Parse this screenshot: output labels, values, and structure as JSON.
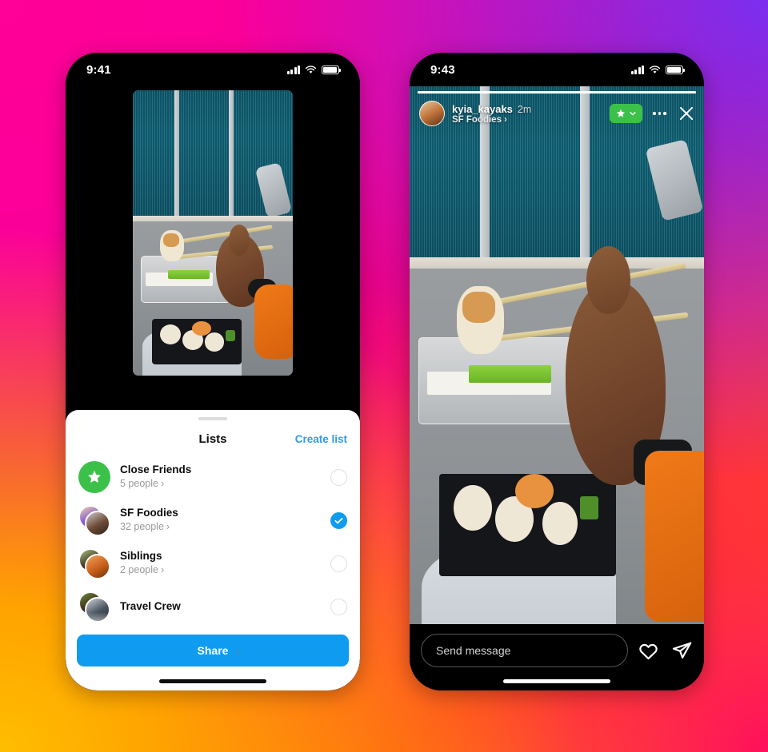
{
  "background": {
    "gradient_colors": [
      "#F5009B",
      "#7B2FF0",
      "#FF0F5B",
      "#FFA300",
      "#FFBE00"
    ]
  },
  "accent_colors": {
    "instagram_blue": "#0f9bf0",
    "close_friends_green": "#3BC14A",
    "link_blue": "#2e9cf0"
  },
  "left_phone": {
    "status_bar": {
      "time": "9:41",
      "signal": "signal-bars-icon",
      "wifi": "wifi-icon",
      "battery": "battery-icon"
    },
    "sheet": {
      "grabber": "drag-handle",
      "title": "Lists",
      "create_list_label": "Create list",
      "items": [
        {
          "name": "Close Friends",
          "people": "5 people",
          "chevron": "›",
          "avatar_type": "star-badge",
          "selected": false
        },
        {
          "name": "SF Foodies",
          "people": "32 people",
          "chevron": "›",
          "avatar_type": "photo-cluster",
          "selected": true
        },
        {
          "name": "Siblings",
          "people": "2 people",
          "chevron": "›",
          "avatar_type": "photo-cluster",
          "selected": false
        },
        {
          "name": "Travel Crew",
          "people": "",
          "chevron": "",
          "avatar_type": "photo-cluster",
          "selected": false
        }
      ],
      "share_label": "Share"
    }
  },
  "right_phone": {
    "status_bar": {
      "time": "9:43",
      "signal": "signal-bars-icon",
      "wifi": "wifi-icon",
      "battery": "battery-icon"
    },
    "story": {
      "progress_percent": 100,
      "username": "kyia_kayaks",
      "timestamp": "2m",
      "audience_label": "SF Foodies",
      "audience_chevron": "›",
      "close_friends_badge": "star-icon",
      "badge_chevron": "chevron-down-icon",
      "more_menu": "more-options-icon",
      "close": "close-icon"
    },
    "footer": {
      "message_placeholder": "Send message",
      "like": "heart-icon",
      "share": "paper-plane-icon"
    }
  }
}
